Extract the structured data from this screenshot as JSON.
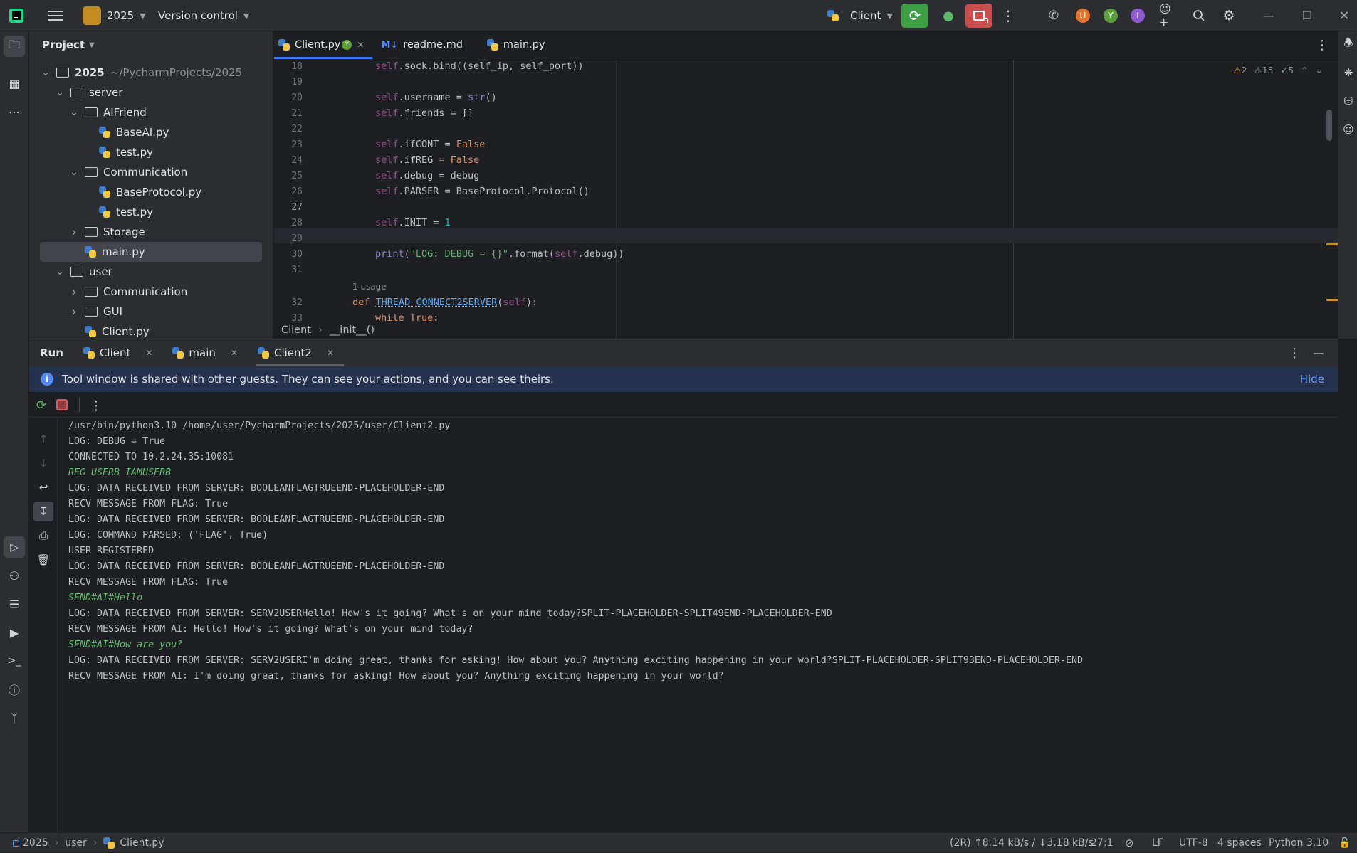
{
  "titlebar": {
    "project": "2025",
    "vcs": "Version control",
    "run_config": "Client",
    "notif_count": "3",
    "avatars": [
      "U",
      "Y",
      "I"
    ],
    "colors": {
      "project_badge": "#c18b22",
      "run_green": "#3f9f45",
      "stop_red": "#c94f4f",
      "avatar_u": "#e4742d",
      "avatar_y": "#5ca03e",
      "avatar_i": "#8f5ccf"
    }
  },
  "project_panel": {
    "title": "Project",
    "items": [
      {
        "label": "2025",
        "extra": "~/PycharmProjects/2025",
        "type": "folder",
        "depth": 0,
        "open": true
      },
      {
        "label": "server",
        "type": "folder",
        "depth": 1,
        "open": true
      },
      {
        "label": "AIFriend",
        "type": "folder",
        "depth": 2,
        "open": true
      },
      {
        "label": "BaseAI.py",
        "type": "py",
        "depth": 3
      },
      {
        "label": "test.py",
        "type": "py",
        "depth": 3
      },
      {
        "label": "Communication",
        "type": "folder",
        "depth": 2,
        "open": true
      },
      {
        "label": "BaseProtocol.py",
        "type": "py",
        "depth": 3
      },
      {
        "label": "test.py",
        "type": "py",
        "depth": 3
      },
      {
        "label": "Storage",
        "type": "folder",
        "depth": 2,
        "open": false
      },
      {
        "label": "main.py",
        "type": "py",
        "depth": 2,
        "selected": true
      },
      {
        "label": "user",
        "type": "folder",
        "depth": 1,
        "open": true
      },
      {
        "label": "Communication",
        "type": "folder",
        "depth": 2,
        "open": false
      },
      {
        "label": "GUI",
        "type": "folder",
        "depth": 2,
        "open": false
      },
      {
        "label": "Client.py",
        "type": "py",
        "depth": 2
      }
    ]
  },
  "editor": {
    "tabs": [
      {
        "label": "Client.py",
        "badge": "Y",
        "active": true
      },
      {
        "label": "readme.md",
        "prefix": "M↓"
      },
      {
        "label": "main.py"
      }
    ],
    "inspections": {
      "warn1": "2",
      "warn2": "15",
      "ok": "5"
    },
    "usage_hint": "1 usage",
    "breadcrumb": [
      "Client",
      "__init__()"
    ]
  },
  "run_panel": {
    "title": "Run",
    "tabs": [
      "Client",
      "main",
      "Client2"
    ],
    "notice": "Tool window is shared with other guests. They can see your actions, and you can see theirs.",
    "hide": "Hide",
    "console": [
      {
        "t": "/usr/bin/python3.10 /home/user/PycharmProjects/2025/user/Client2.py",
        "k": "out"
      },
      {
        "t": "LOG: DEBUG = True",
        "k": "out"
      },
      {
        "t": "CONNECTED TO 10.2.24.35:10081",
        "k": "out"
      },
      {
        "t": "REG USERB IAMUSERB",
        "k": "in"
      },
      {
        "t": "LOG: DATA RECEIVED FROM SERVER: BOOLEANFLAGTRUEEND-PLACEHOLDER-END",
        "k": "out"
      },
      {
        "t": "RECV MESSAGE FROM FLAG: True",
        "k": "out"
      },
      {
        "t": "LOG: DATA RECEIVED FROM SERVER: BOOLEANFLAGTRUEEND-PLACEHOLDER-END",
        "k": "out"
      },
      {
        "t": "LOG: COMMAND PARSED: ('FLAG', True)",
        "k": "out"
      },
      {
        "t": "USER REGISTERED",
        "k": "out"
      },
      {
        "t": "LOG: DATA RECEIVED FROM SERVER: BOOLEANFLAGTRUEEND-PLACEHOLDER-END",
        "k": "out"
      },
      {
        "t": "RECV MESSAGE FROM FLAG: True",
        "k": "out"
      },
      {
        "t": "SEND#AI#Hello",
        "k": "in"
      },
      {
        "t": "LOG: DATA RECEIVED FROM SERVER: SERV2USERHello! How's it going? What's on your mind today?SPLIT-PLACEHOLDER-SPLIT49END-PLACEHOLDER-END",
        "k": "out"
      },
      {
        "t": "RECV MESSAGE FROM AI: Hello! How's it going? What's on your mind today?",
        "k": "out"
      },
      {
        "t": "SEND#AI#How are you?",
        "k": "in"
      },
      {
        "t": "LOG: DATA RECEIVED FROM SERVER: SERV2USERI'm doing great, thanks for asking! How about you? Anything exciting happening in your world?SPLIT-PLACEHOLDER-SPLIT93END-PLACEHOLDER-END",
        "k": "out"
      },
      {
        "t": "RECV MESSAGE FROM AI: I'm doing great, thanks for asking! How about you? Anything exciting happening in your world?",
        "k": "out"
      }
    ]
  },
  "status": {
    "path": [
      "2025",
      "user",
      "Client.py"
    ],
    "net": "(2R) ↑8.14 kB/s / ↓3.18 kB/s",
    "pos": "27:1",
    "eol": "LF",
    "enc": "UTF-8",
    "indent": "4 spaces",
    "interp": "Python 3.10"
  }
}
